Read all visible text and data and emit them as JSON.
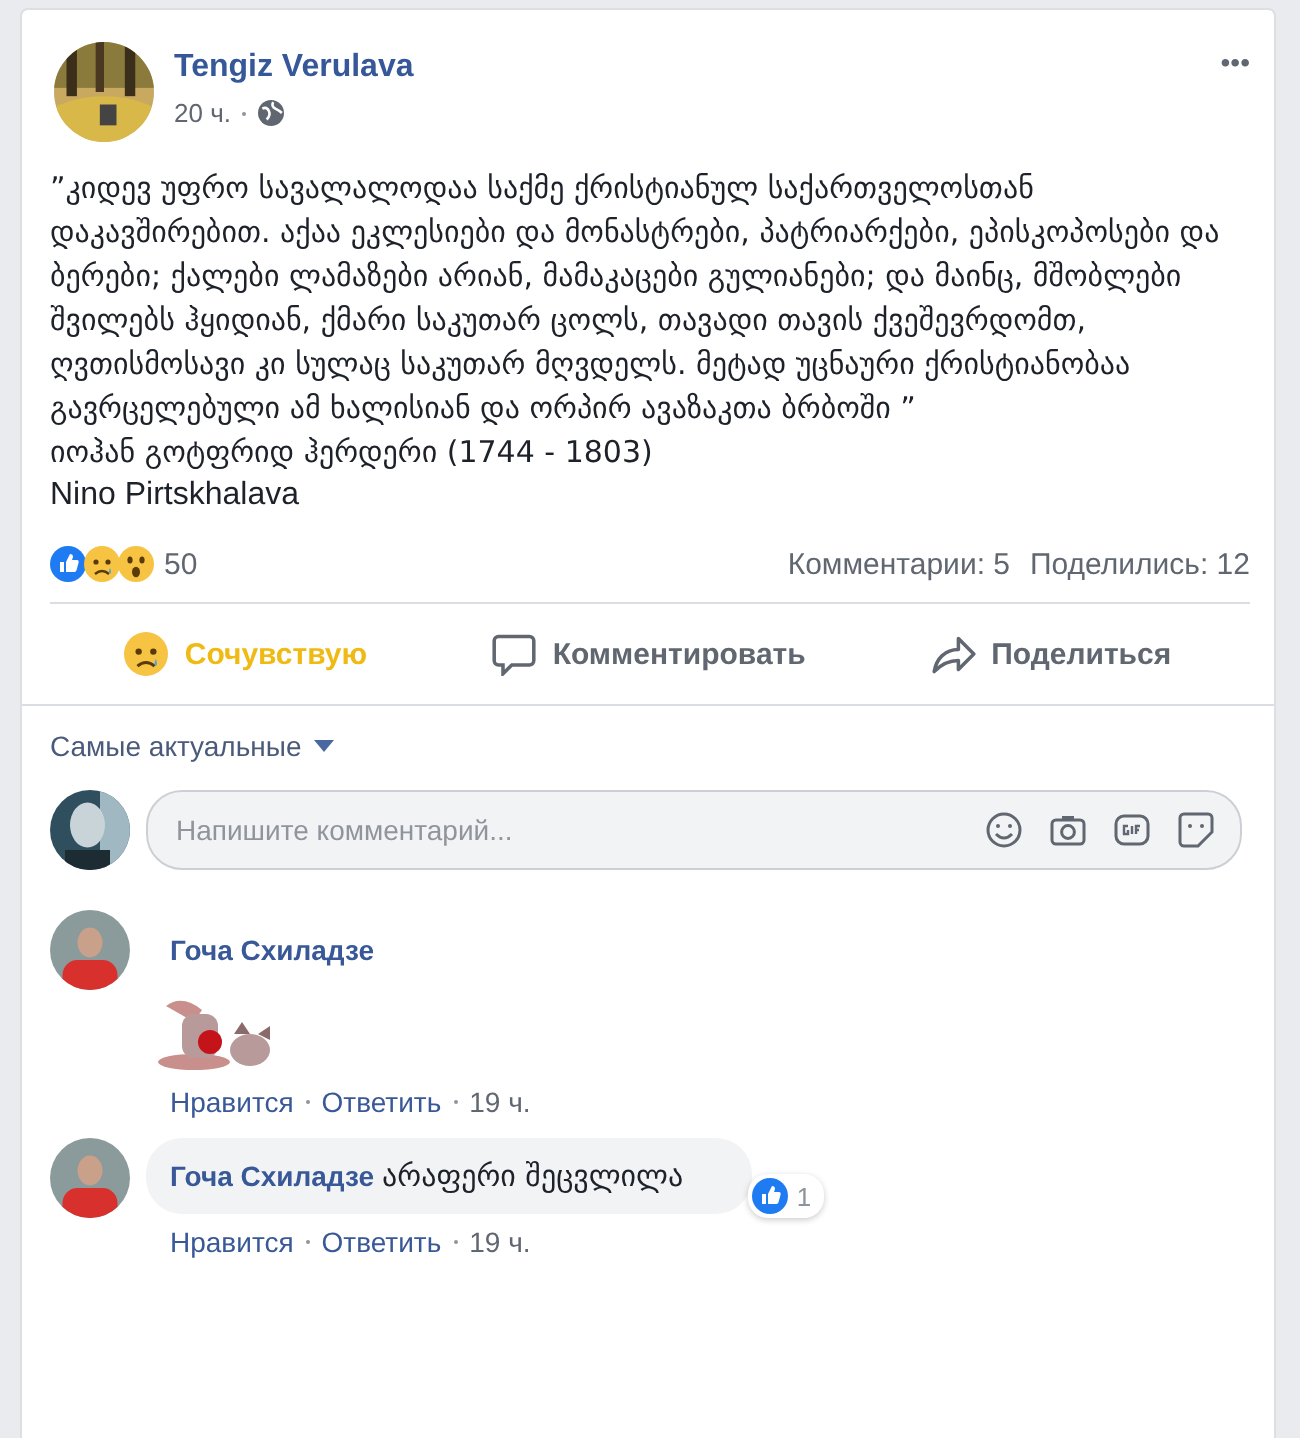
{
  "post": {
    "author": "Tengiz Verulava",
    "time": "20 ч.",
    "more": "•••",
    "paragraphs": [
      "”კიდევ უფრო სავალალოდაა საქმე ქრისტიანულ საქართველოსთან დაკავშირებით. აქაა ეკლესიები და მონასტრები, პატრიარქები, ეპისკოპოსები და ბერები; ქალები ლამაზები არიან, მამაკაცები გულიანები; და მაინც, მშობლები შვილებს ჰყიდიან, ქმარი საკუთარ ცოლს, თავადი თავის ქვეშევრდომთ, ღვთისმოსავი კი სულაც საკუთარ მღვდელს. მეტად უცნაური ქრისტიანობაა გავრცელებული ამ ხალისიან და ორპირ ავაზაკთა ბრბოში ”",
      "იოჰან გოტფრიდ ჰერდერი (1744 - 1803)",
      "Nino Pirtskhalava"
    ]
  },
  "stats": {
    "reactions": [
      {
        "kind": "like"
      },
      {
        "kind": "sad"
      },
      {
        "kind": "wow"
      }
    ],
    "reaction_count": "50",
    "comments": "Комментарии: 5",
    "shares": "Поделились: 12"
  },
  "actions": [
    {
      "kind": "react",
      "label": "Сочувствую",
      "active": true
    },
    {
      "kind": "comment",
      "label": "Комментировать",
      "active": false
    },
    {
      "kind": "share",
      "label": "Поделиться",
      "active": false
    }
  ],
  "sort": "Самые актуальные",
  "composer": {
    "placeholder": "Напишите комментарий..."
  },
  "comments": [
    {
      "kind": "sticker",
      "author": "Гоча Схиладзе",
      "actions": [
        "Нравится",
        "Ответить",
        "19 ч."
      ]
    },
    {
      "kind": "text",
      "author": "Гоча Схиладзе",
      "text": "არაფერი შეცვლილა",
      "likes": "1",
      "actions": [
        "Нравится",
        "Ответить",
        "19 ч."
      ]
    }
  ]
}
